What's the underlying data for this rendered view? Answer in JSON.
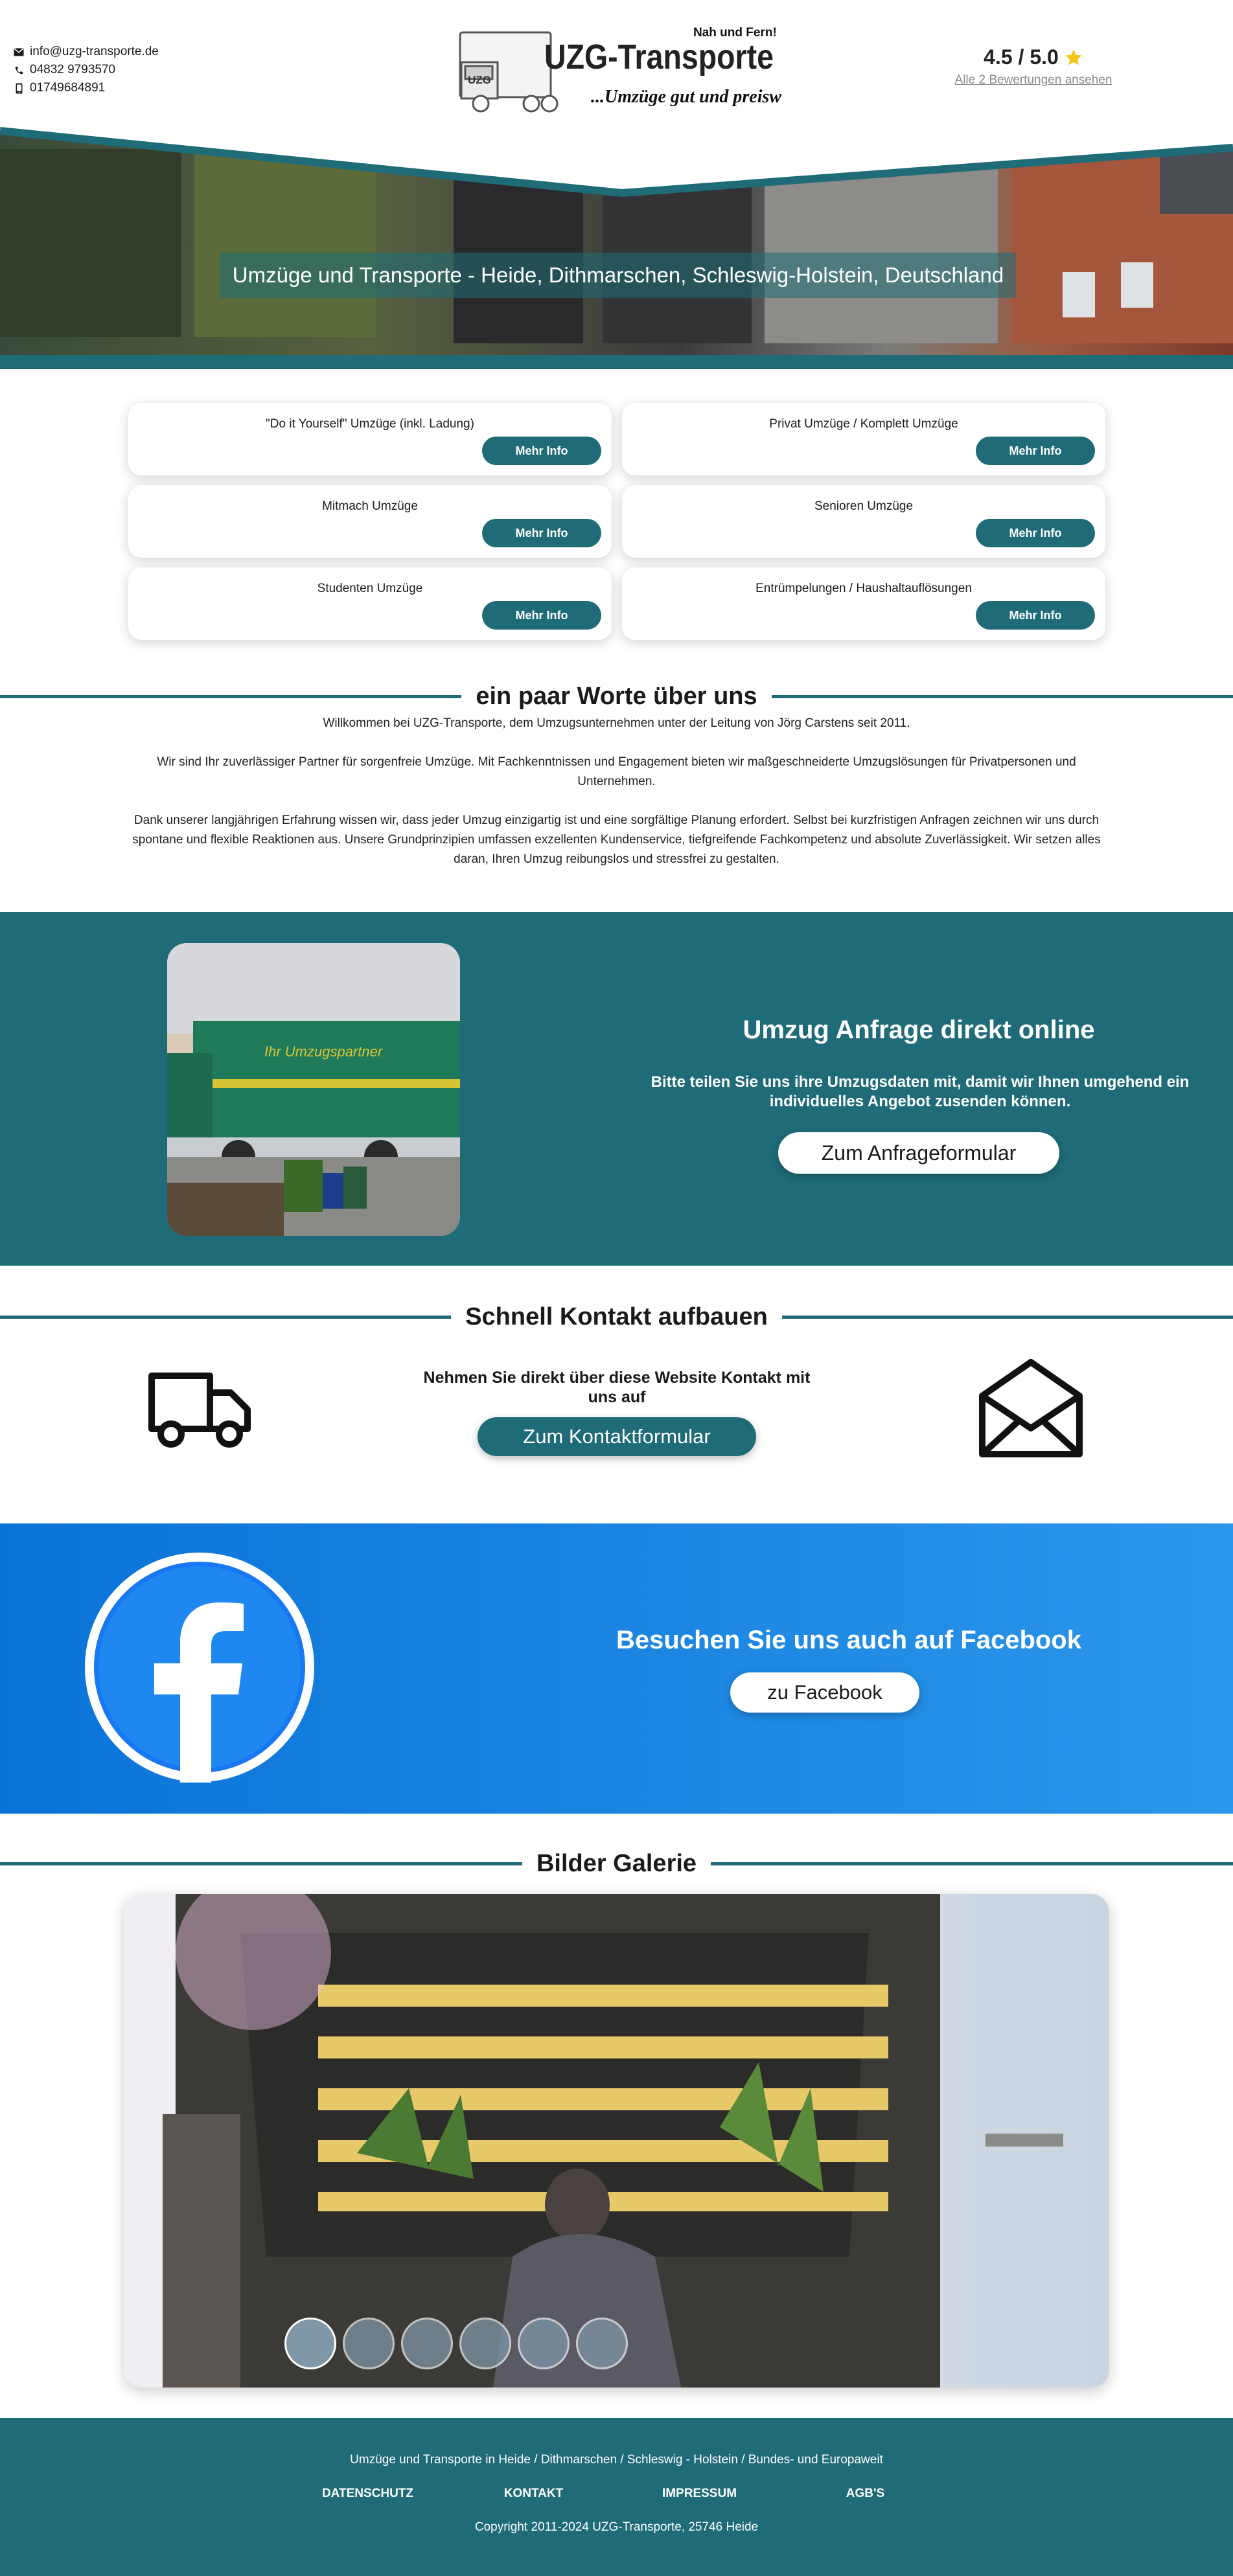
{
  "header": {
    "email": "info@uzg-transporte.de",
    "phone": "04832 9793570",
    "mobile": "01749684891",
    "logo": {
      "brand": "UZG-Transporte",
      "slogan_top": "Nah und Fern!",
      "slogan_bottom": "...Umzüge gut und preiswert",
      "truck_badge": "UZG"
    },
    "rating": {
      "score": "4.5 / 5.0",
      "reviews_link": "Alle 2 Bewertungen ansehen"
    }
  },
  "hero": {
    "title": "Umzüge und Transporte - Heide, Dithmarschen, Schleswig-Holstein, Deutschland"
  },
  "services": [
    {
      "title": "\"Do it Yourself\" Umzüge (inkl. Ladung)",
      "button": "Mehr Info"
    },
    {
      "title": "Privat Umzüge / Komplett Umzüge",
      "button": "Mehr Info"
    },
    {
      "title": "Mitmach Umzüge",
      "button": "Mehr Info"
    },
    {
      "title": "Senioren Umzüge",
      "button": "Mehr Info"
    },
    {
      "title": "Studenten Umzüge",
      "button": "Mehr Info"
    },
    {
      "title": "Entrümpelungen / Haushaltauflösungen",
      "button": "Mehr Info"
    }
  ],
  "about": {
    "heading": "ein paar Worte über uns",
    "p1": "Willkommen bei UZG-Transporte, dem Umzugsunternehmen unter der Leitung von Jörg Carstens seit 2011.",
    "p2": "Wir sind Ihr zuverlässiger Partner für sorgenfreie Umzüge. Mit Fachkenntnissen und Engagement bieten wir maßgeschneiderte Umzugslösungen für Privatpersonen und Unternehmen.",
    "p3": "Dank unserer langjährigen Erfahrung wissen wir, dass jeder Umzug einzigartig ist und eine sorgfältige Planung erfordert. Selbst bei kurzfristigen Anfragen zeichnen wir uns durch spontane und flexible Reaktionen aus. Unsere Grundprinzipien umfassen exzellenten Kundenservice, tiefgreifende Fachkompetenz und absolute Zuverlässigkeit. Wir setzen alles daran, Ihren Umzug reibungslos und stressfrei zu gestalten."
  },
  "request": {
    "truck_text": "Ihr Umzugspartner",
    "title": "Umzug Anfrage direkt online",
    "description": "Bitte teilen Sie uns ihre Umzugsdaten mit, damit wir Ihnen umgehend ein individuelles Angebot zusenden können.",
    "button": "Zum Anfrageformular"
  },
  "quick_contact": {
    "heading": "Schnell Kontakt aufbauen",
    "description": "Nehmen Sie direkt über diese Website Kontakt mit uns auf",
    "button": "Zum Kontaktformular"
  },
  "facebook": {
    "title": "Besuchen Sie uns auch auf Facebook",
    "button": "zu Facebook",
    "colors": {
      "start": "#0a73d8",
      "end": "#2b96ea"
    }
  },
  "gallery": {
    "heading": "Bilder Galerie",
    "thumbnail_count": 6,
    "active_thumbnail": 1
  },
  "footer": {
    "tagline": "Umzüge und Transporte in Heide / Dithmarschen / Schleswig - Holstein / Bundes- und Europaweit",
    "links": [
      "DATENSCHUTZ",
      "KONTAKT",
      "IMPRESSUM",
      "AGB'S"
    ],
    "copyright": "Copyright 2011-2024 UZG-Transporte, 25746 Heide"
  },
  "colors": {
    "primary": "#1f6b78",
    "white": "#ffffff",
    "star": "#f5c518"
  }
}
